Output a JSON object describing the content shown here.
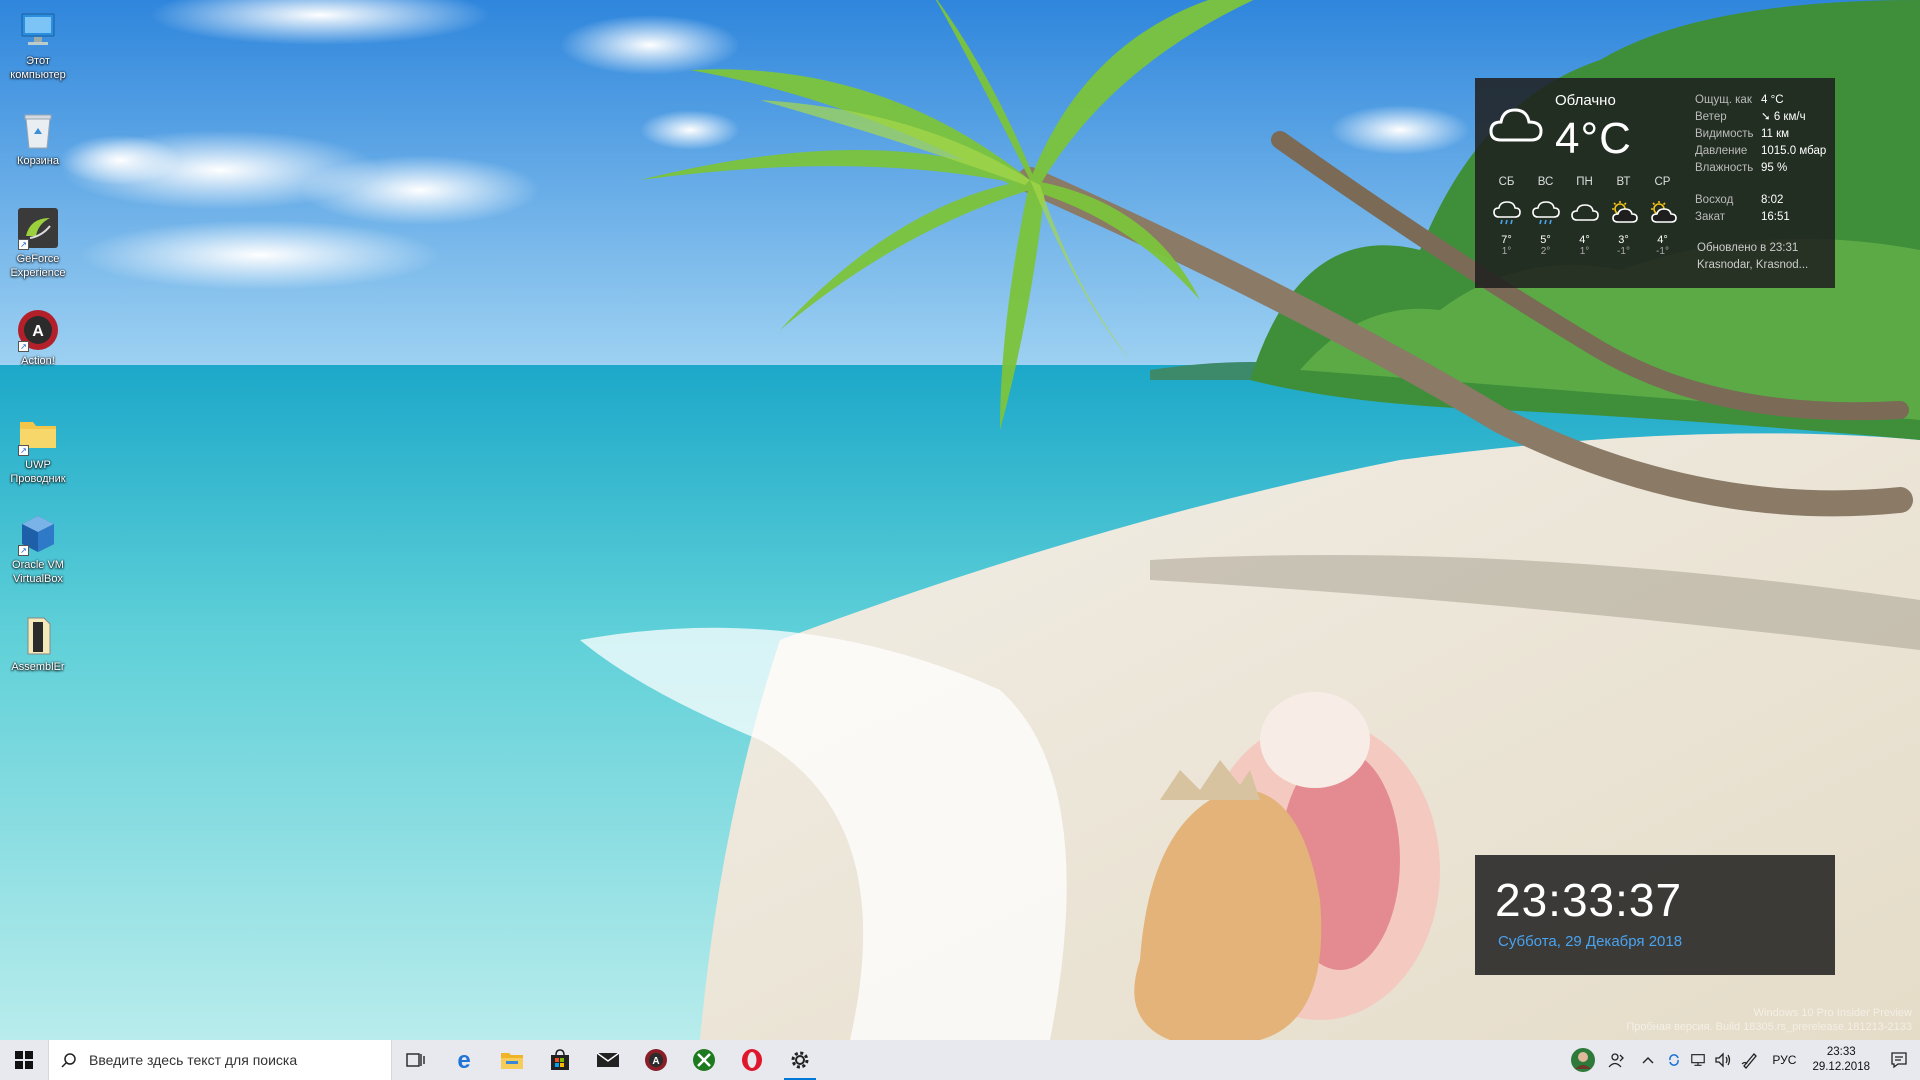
{
  "desktop": {
    "icons": [
      {
        "label": "Этот компьютер",
        "icon": "computer-icon"
      },
      {
        "label": "Корзина",
        "icon": "recycle-bin-icon"
      },
      {
        "label": "GeForce Experience",
        "icon": "geforce-icon"
      },
      {
        "label": "Action!",
        "icon": "action-recorder-icon"
      },
      {
        "label": "UWP Проводник",
        "icon": "folder-icon"
      },
      {
        "label": "Oracle VM VirtualBox",
        "icon": "virtualbox-icon"
      },
      {
        "label": "AssemblEr",
        "icon": "file-icon"
      }
    ]
  },
  "weather": {
    "condition": "Облачно",
    "temperature": "4°C",
    "details": [
      {
        "key": "Ощущ. как",
        "value": "4 °C"
      },
      {
        "key": "Ветер",
        "value": "6 км/ч"
      },
      {
        "key": "Видимость",
        "value": "11 км"
      },
      {
        "key": "Давление",
        "value": "1015.0 мбар"
      },
      {
        "key": "Влажность",
        "value": "95 %"
      }
    ],
    "forecast": [
      {
        "day": "СБ",
        "icon": "rain-cloud-icon",
        "high": "7°",
        "low": "1°"
      },
      {
        "day": "ВС",
        "icon": "rain-cloud-icon",
        "high": "5°",
        "low": "2°"
      },
      {
        "day": "ПН",
        "icon": "cloud-icon",
        "high": "4°",
        "low": "1°"
      },
      {
        "day": "ВТ",
        "icon": "partly-sunny-icon",
        "high": "3°",
        "low": "-1°"
      },
      {
        "day": "СР",
        "icon": "partly-sunny-icon",
        "high": "4°",
        "low": "-1°"
      }
    ],
    "sunrise_label": "Восход",
    "sunrise": "8:02",
    "sunset_label": "Закат",
    "sunset": "16:51",
    "updated": "Обновлено в 23:31",
    "location": "Krasnodar, Krasnod..."
  },
  "clock": {
    "time": "23:33:37",
    "date": "Суббота, 29 Декабря 2018"
  },
  "watermark": {
    "line1": "Windows 10 Pro Insider Preview",
    "line2": "Пробная версия. Build 18305.rs_prerelease.181213-2133"
  },
  "taskbar": {
    "search_placeholder": "Введите здесь текст для поиска",
    "pinned": [
      "task-view-icon",
      "edge-icon",
      "file-explorer-icon",
      "store-icon",
      "mail-icon",
      "action-app-icon",
      "xbox-icon",
      "opera-icon",
      "settings-icon"
    ],
    "language": "РУС",
    "time": "23:33",
    "date": "29.12.2018"
  },
  "colors": {
    "widget_bg": "#1e1e1e",
    "clock_date": "#4aa3f0",
    "taskbar_bg": "#e7e9ee",
    "accent": "#0078d7"
  }
}
